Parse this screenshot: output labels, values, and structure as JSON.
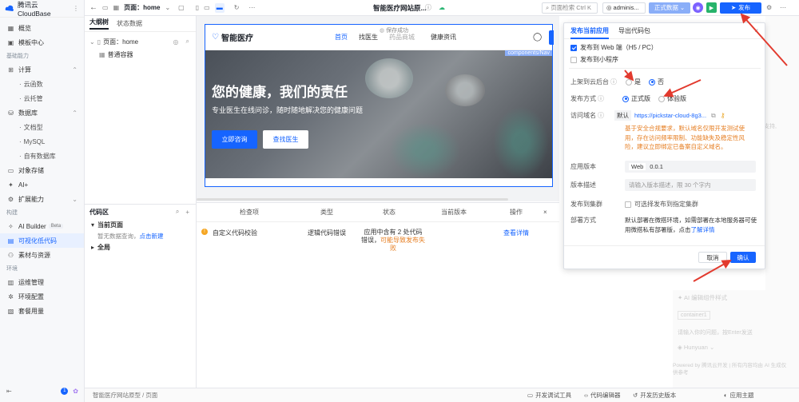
{
  "app": {
    "title": "腾讯云CloudBase",
    "page_title": "智能医疗网站原...",
    "page_selector": "页面：home"
  },
  "colors": {
    "accent": "#1664ff",
    "warning": "#e67e22",
    "arrow": "#e23a2e"
  },
  "sidebar": {
    "top": [
      {
        "label": "概览",
        "icon": "grid-icon"
      },
      {
        "label": "模板中心",
        "icon": "template-icon"
      }
    ],
    "section_infra": "基础能力",
    "compute": {
      "label": "计算",
      "children": [
        "云函数",
        "云托管"
      ]
    },
    "db": {
      "label": "数据库",
      "children": [
        "文档型",
        "MySQL",
        "自有数据库"
      ]
    },
    "infra_rest": [
      {
        "label": "对象存储",
        "icon": "storage-icon"
      },
      {
        "label": "AI+",
        "icon": "sparkle-icon"
      },
      {
        "label": "扩展能力",
        "icon": "plugin-icon"
      }
    ],
    "section_dev": "构建",
    "ai_builder": "AI Builder",
    "beta": "Beta",
    "dev_items": [
      {
        "label": "可视化低代码",
        "icon": "lowcode-icon"
      },
      {
        "label": "素材与资源",
        "icon": "asset-icon"
      }
    ],
    "section_env": "环境",
    "env_items": [
      {
        "label": "运维管理",
        "icon": "ops-icon"
      },
      {
        "label": "环境配置",
        "icon": "env-icon"
      },
      {
        "label": "套餐用量",
        "icon": "usage-icon"
      }
    ],
    "notif_count": "1"
  },
  "topbar": {
    "search": "页面检索 Ctrl K",
    "user": "adminis...",
    "env_btn": "正式数据",
    "publish": "发布",
    "save_status": "保存成功",
    "save_sub": "药品商城"
  },
  "leftpanel": {
    "tabs": [
      "大纲树",
      "状态数据"
    ],
    "tree_page": "页面：home",
    "tree_child": "普通容器",
    "code_title": "代码区",
    "code_current": "当前页面",
    "code_empty": "暂无数据查询，",
    "code_new": "点击新建",
    "code_global": "全局"
  },
  "canvas": {
    "brand": "智能医疗",
    "nav": [
      "首页",
      "找医生",
      "药品商城",
      "健康资讯"
    ],
    "component_tag": "components/Nav",
    "hero_title": "您的健康，我们的责任",
    "hero_sub": "专业医生在线问诊，随时随地解决您的健康问题",
    "btn_primary": "立即咨询",
    "btn_secondary": "查找医生"
  },
  "checks": {
    "headers": [
      "检查项",
      "类型",
      "状态",
      "当前版本",
      "操作"
    ],
    "row": {
      "item": "自定义代码校验",
      "type": "逻辑代码错误",
      "status_line1": "应用中含有 2 处代码",
      "status_line2": "错误，",
      "status_warn": "可能导致发布失败",
      "action": "查看详情"
    }
  },
  "publish": {
    "tabs": [
      "发布当前应用",
      "导出代码包"
    ],
    "opt_web": "发布到 Web 端（H5 / PC）",
    "opt_mp": "发布到小程序",
    "cloud_label": "上架到云后台",
    "cloud_yes": "是",
    "cloud_no": "否",
    "mode_label": "发布方式",
    "mode_prod": "正式版",
    "mode_exp": "体验版",
    "domain_label": "访问域名",
    "domain_tag": "默认",
    "domain_url": "https://pickstar-cloud-8g3...",
    "domain_warn": "基于安全合规要求，默认域名仅限开发测试使用，存在访问频率限制、功能缺失及稳定性风险，建议立即绑定已备案自定义域名。",
    "version_label": "应用版本",
    "version_tag": "Web",
    "version_val": "0.0.1",
    "desc_label": "版本描述",
    "desc_placeholder": "请输入版本描述，限 30 个字内",
    "cluster_label": "发布到集群",
    "cluster_opt": "可选择发布到指定集群",
    "deploy_label": "部署方式",
    "deploy_text": "默认部署在微搭环境，如需部署在本地服务器可使用微搭私有部署版，点击",
    "deploy_link": "了解详情",
    "cancel": "取消",
    "confirm": "确认"
  },
  "right": {
    "ghost_title": "pilot",
    "ghost_sub": "支持,",
    "ghost_bottom": "AI 编辑组件样式",
    "ghost_tag": "container1",
    "ghost_hint": "请输入你的问题，按Enter发送",
    "ghost_model": "Hunyuan",
    "ghost_footer": "Powered by 腾讯云开发 | 所有内容均由 AI 生成仅供参考"
  },
  "statusbar": {
    "breadcrumb": "智能医疗网站原型 / 页面",
    "items": [
      "开发调试工具",
      "代码编辑器",
      "开发历史版本"
    ],
    "theme": "应用主题"
  }
}
